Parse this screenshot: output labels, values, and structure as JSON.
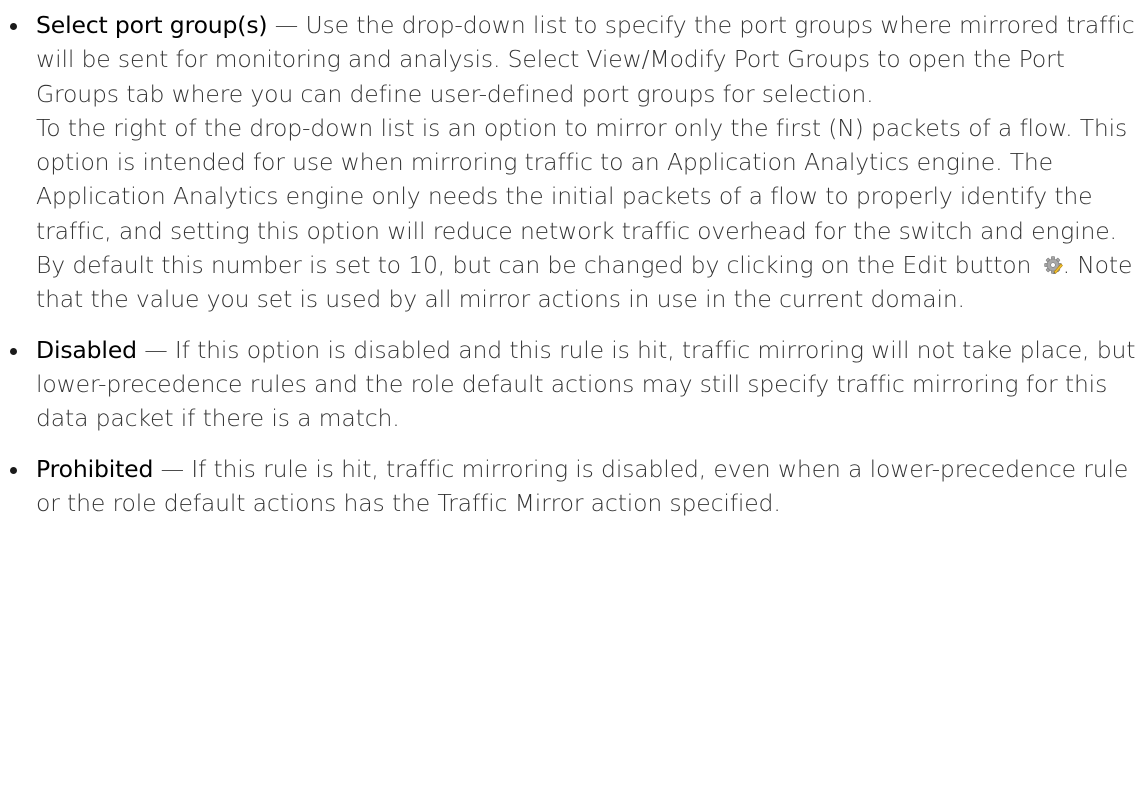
{
  "items": [
    {
      "term": "Select port group(s)",
      "dash": " — ",
      "text": "Use the drop-down list to specify the port groups where mirrored traffic will be sent for monitoring and analysis. Select View/Modify Port Groups to open the Port Groups tab where you can define user-defined port groups for selection.",
      "para2_before_icon": "To the right of the drop-down list is an option to mirror only the first (N) packets of a flow. This option is intended for use when mirroring traffic to an Application Analytics engine. The Application Analytics engine only needs the initial packets of a flow to properly identify the traffic, and setting this option will reduce network traffic overhead for the switch and engine. By default this number is set to 10, but can be changed by clicking on the Edit button",
      "edit_icon": "edit-gear-icon",
      "para2_after_icon": ". Note that the value you set is used by all mirror actions in use in the current domain."
    },
    {
      "term": "Disabled",
      "dash": " — ",
      "text": "If this option is disabled and this rule is hit, traffic mirroring will not take place, but lower-precedence rules and the role default actions may still specify traffic mirroring for this data packet if there is a match."
    },
    {
      "term": "Prohibited",
      "dash": " — ",
      "text": "If this rule is hit, traffic mirroring is disabled, even when a lower-precedence rule or the role default actions has the Traffic Mirror action specified."
    }
  ]
}
